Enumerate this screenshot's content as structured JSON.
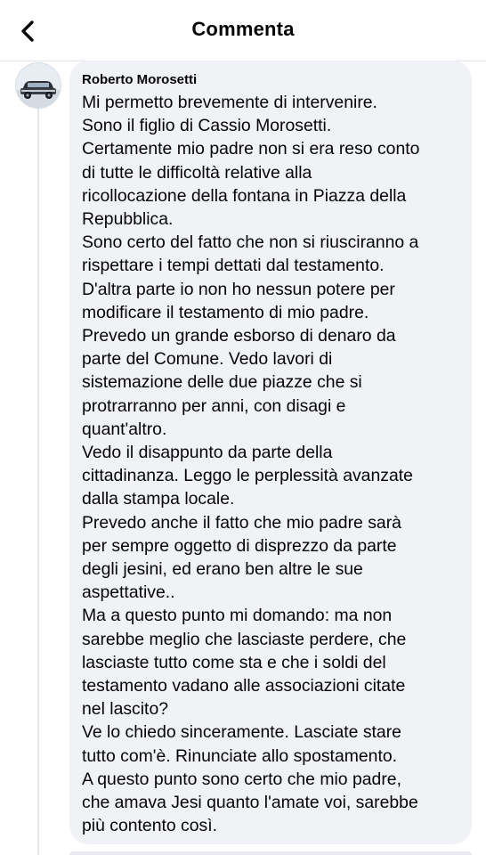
{
  "header": {
    "title": "Commenta",
    "back_icon": "chevron-left-icon"
  },
  "comment": {
    "author": "Roberto Morosetti",
    "avatar_icon": "vintage-car-avatar",
    "lines": [
      "Mi permetto brevemente di intervenire.",
      "Sono il figlio di Cassio Morosetti.",
      "Certamente mio padre non si era reso conto",
      "di tutte le difficoltà relative alla",
      "ricollocazione della fontana in Piazza della",
      "Repubblica.",
      "Sono certo del fatto che non si riusciranno a",
      "rispettare i tempi dettati dal testamento.",
      "D'altra parte io non ho nessun potere per",
      "modificare il testamento di mio padre.",
      "Prevedo un grande esborso di denaro da",
      "parte del Comune. Vedo lavori di",
      "sistemazione delle due piazze che si",
      "protrarranno per anni, con disagi e",
      "quant'altro.",
      "Vedo il disappunto da parte della",
      "cittadinanza. Leggo le perplessità avanzate",
      "dalla stampa locale.",
      "Prevedo anche il fatto che mio padre sarà",
      "per sempre oggetto di disprezzo da parte",
      "degli jesini, ed erano ben altre le sue",
      "aspettative..",
      "Ma a questo punto mi domando: ma non",
      "sarebbe meglio che lasciaste perdere, che",
      "lasciaste tutto come sta e che i soldi del",
      "testamento vadano alle associazioni citate",
      "nel lascito?",
      "Ve lo chiedo sinceramente. Lasciate stare",
      "tutto com'è. Rinunciate allo spostamento.",
      "A questo punto sono certo che mio padre,",
      "che amava Jesi quanto l'amate voi,  sarebbe",
      "più contento così."
    ]
  },
  "colors": {
    "bubble": "#f0f2f5",
    "text": "#050505",
    "divider": "#e4e6eb"
  }
}
